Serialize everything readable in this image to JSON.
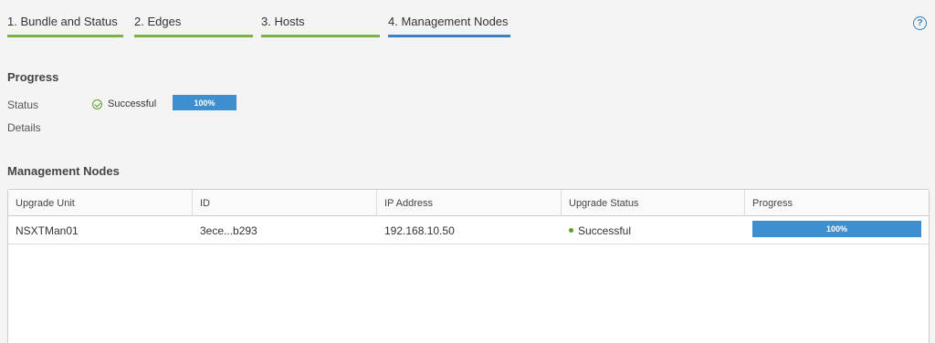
{
  "steps": [
    {
      "label": "1. Bundle and Status",
      "state": "done"
    },
    {
      "label": "2. Edges",
      "state": "done"
    },
    {
      "label": "3. Hosts",
      "state": "done"
    },
    {
      "label": "4. Management Nodes",
      "state": "active"
    }
  ],
  "help": {
    "glyph": "?"
  },
  "progress": {
    "title": "Progress",
    "status_label": "Status",
    "status_value": "Successful",
    "percent_text": "100%",
    "percent": 100,
    "details_label": "Details"
  },
  "mgmt": {
    "title": "Management Nodes",
    "columns": [
      "Upgrade Unit",
      "ID",
      "IP Address",
      "Upgrade Status",
      "Progress"
    ],
    "rows": [
      {
        "unit": "NSXTMan01",
        "id": "3ece...b293",
        "ip": "192.168.10.50",
        "status": "Successful",
        "progress_text": "100%",
        "progress": 100
      }
    ]
  },
  "colors": {
    "done": "#7cb342",
    "active": "#3b82c4",
    "success": "#5aa02c",
    "progress": "#3d8fcf"
  }
}
